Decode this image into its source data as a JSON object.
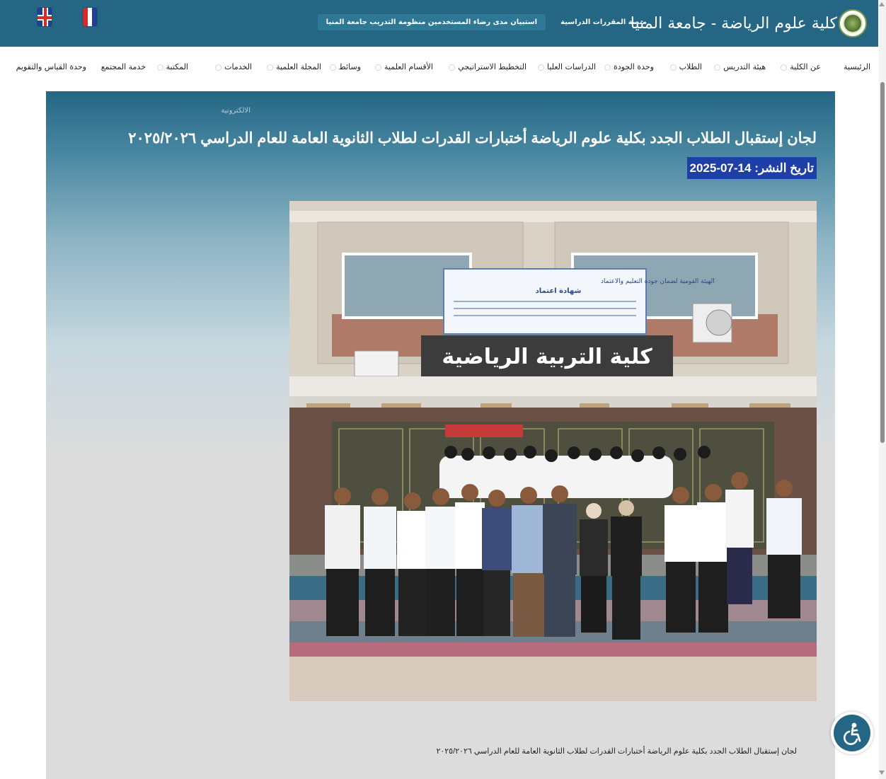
{
  "header": {
    "site_title": "كلية علوم الرياضة - جامعة المنيا",
    "top_links": [
      "منصة المقررات الدراسية",
      "استبيان مدى رضاء المستخدمين منظومة التدريب جامعة المنيا"
    ],
    "languages": [
      "English",
      "Français"
    ]
  },
  "nav": {
    "items": [
      "الرئيسية",
      "عن الكلية",
      "هيئة التدريس",
      "الطلاب",
      "وحدة الجودة",
      "الدراسات العليا",
      "التخطيط الاستراتيجي",
      "الأقسام العلمية",
      "وسائط",
      "المجلة العلمية",
      "الخدمات",
      "المكتبة",
      "خدمة المجتمع",
      "وحدة القياس والتقويم"
    ]
  },
  "article": {
    "category": "الالكترونية",
    "title": "لجان إستقبال الطلاب الجدد بكلية علوم الرياضة أختبارات القدرات لطلاب الثانوية العامة للعام الدراسي ٢٠٢٥/٢٠٢٦",
    "date_label": "تاريخ النشر:",
    "date_value": "2025-07-14",
    "photo": {
      "building_sign": "كلية التربية الرياضية",
      "certificate_title": "الهيئة القومية لضمان جودة التعليم والاعتماد",
      "certificate_subtitle": "شهادة اعتماد"
    },
    "caption": "لجان إستقبال الطلاب الجدد بكلية علوم الرياضة أختبارات القدرات لطلاب الثانوية العامة للعام الدراسي ٢٠٢٥/٢٠٢٦"
  },
  "colors": {
    "header_bg": "#246683",
    "date_bg": "#1f3fa8"
  }
}
